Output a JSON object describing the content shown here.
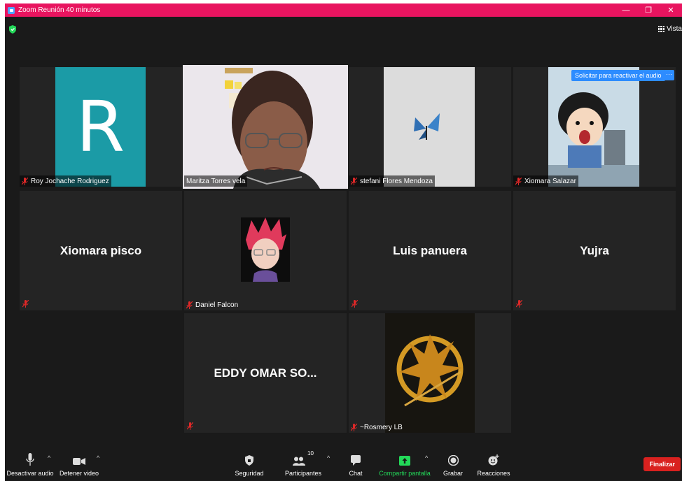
{
  "window": {
    "title": "Zoom Reunión 40 minutos",
    "minimize": "—",
    "restore": "❐",
    "close": "✕"
  },
  "top": {
    "view_label": "Vista"
  },
  "tooltip": {
    "text": "Solicitar para reactivar el audio",
    "more": "···"
  },
  "participants": [
    {
      "name": "Roy Jochache Rodriguez",
      "initial": "R",
      "muted": true
    },
    {
      "name": "Maritza Torres vela",
      "muted": false,
      "active_speaker": true
    },
    {
      "name": "stefani Flores Mendoza",
      "muted": true
    },
    {
      "name": "Xiomara Salazar",
      "muted": true
    },
    {
      "name": "Xiomara pisco",
      "muted": true
    },
    {
      "name": "Daniel Falcon",
      "muted": true
    },
    {
      "name": "Luis panuera",
      "muted": true
    },
    {
      "name": "Yujra",
      "muted": true
    },
    {
      "name": "EDDY OMAR SO...",
      "muted": true
    },
    {
      "name": "~Rosmery LB",
      "muted": true
    }
  ],
  "toolbar": {
    "mute_label": "Desactivar audio",
    "video_label": "Detener video",
    "security_label": "Seguridad",
    "participants_label": "Participantes",
    "participants_count": "10",
    "chat_label": "Chat",
    "share_label": "Compartir pantalla",
    "record_label": "Grabar",
    "reactions_label": "Reacciones",
    "end_label": "Finalizar"
  },
  "colors": {
    "titlebar": "#e8145f",
    "background": "#1a1a1a",
    "tile": "#242424",
    "active_border": "#d3ee5b",
    "share_green": "#23d959",
    "end_red": "#d9211f",
    "avatar_teal": "#1b9ba6",
    "tooltip_blue": "#2d8cff"
  }
}
